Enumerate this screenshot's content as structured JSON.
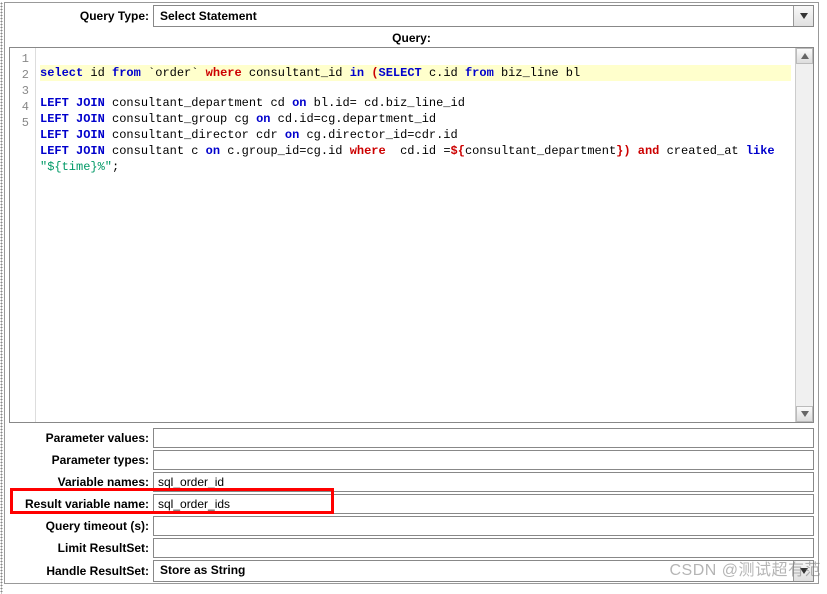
{
  "queryType": {
    "label": "Query Type:",
    "value": "Select Statement"
  },
  "queryHeader": "Query:",
  "code": {
    "lineNumbers": [
      "1",
      "2",
      "3",
      "4",
      "5"
    ],
    "tokens": {
      "select": "select",
      "id": "id",
      "from": "from",
      "order": "`order`",
      "where": "where",
      "consultant_id": "consultant_id",
      "in": "in",
      "SELECT": "SELECT",
      "c_id": "c.id",
      "biz_line": "biz_line",
      "bl": "bl",
      "LEFT": "LEFT",
      "JOIN": "JOIN",
      "on": "on",
      "cd": "consultant_department cd",
      "l2a": "bl.id=",
      "l2b": "cd.biz_line_id",
      "cg": "consultant_group cg",
      "l3a": "cd.id=cg.department_id",
      "cdr": "consultant_director cdr",
      "l4a": "cg.director_id=cdr.id",
      "c": "consultant c",
      "l5a": "c.group_id=cg.id",
      "l5w": "where",
      "l5b": "cd.id =",
      "param": "${consultant_department}",
      "and": "and",
      "created_at": "created_at",
      "like": "like",
      "time": "\"${time}%\"",
      "semi": ";"
    }
  },
  "fields": {
    "paramValues": {
      "label": "Parameter values:",
      "value": ""
    },
    "paramTypes": {
      "label": "Parameter types:",
      "value": ""
    },
    "varNames": {
      "label": "Variable names:",
      "value": "sql_order_id"
    },
    "resultVar": {
      "label": "Result variable name:",
      "value": "sql_order_ids"
    },
    "timeout": {
      "label": "Query timeout (s):",
      "value": ""
    },
    "limit": {
      "label": "Limit ResultSet:",
      "value": ""
    },
    "handle": {
      "label": "Handle ResultSet:",
      "value": "Store as String"
    }
  },
  "watermark": "CSDN @测试超有范"
}
